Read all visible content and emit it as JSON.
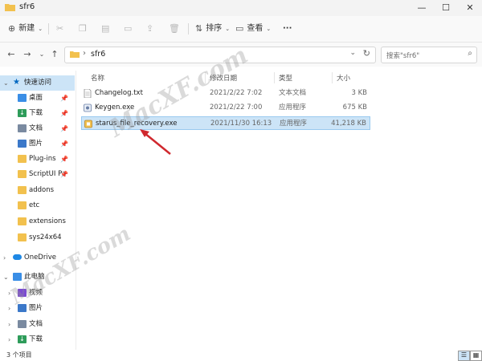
{
  "window": {
    "title": "sfr6",
    "minimize": "—",
    "maximize": "☐",
    "close": "✕"
  },
  "toolbar": {
    "new_label": "新建",
    "sort_label": "排序",
    "view_label": "查看",
    "more_label": "···"
  },
  "address": {
    "path": "sfr6",
    "separator": "›"
  },
  "search": {
    "placeholder": "搜索\"sfr6\""
  },
  "sidebar": {
    "items": [
      {
        "label": "快速访问",
        "icon": "star-icon",
        "expanded": true,
        "selected": true
      },
      {
        "label": "桌面",
        "icon": "desktop-icon",
        "pinned": true
      },
      {
        "label": "下载",
        "icon": "download-icon",
        "pinned": true
      },
      {
        "label": "文档",
        "icon": "document-icon",
        "pinned": true
      },
      {
        "label": "图片",
        "icon": "picture-icon",
        "pinned": true
      },
      {
        "label": "Plug-ins",
        "icon": "folder-icon",
        "pinned": true
      },
      {
        "label": "ScriptUI Pa",
        "icon": "folder-icon",
        "pinned": true
      },
      {
        "label": "addons",
        "icon": "folder-icon"
      },
      {
        "label": "etc",
        "icon": "folder-icon"
      },
      {
        "label": "extensions",
        "icon": "folder-icon"
      },
      {
        "label": "sys24x64",
        "icon": "folder-icon"
      },
      {
        "label": "OneDrive",
        "icon": "cloud-icon"
      },
      {
        "label": "此电脑",
        "icon": "computer-icon",
        "expanded": true
      },
      {
        "label": "视频",
        "icon": "video-icon"
      },
      {
        "label": "图片",
        "icon": "picture-icon"
      },
      {
        "label": "文档",
        "icon": "document-icon"
      },
      {
        "label": "下载",
        "icon": "download-icon"
      }
    ]
  },
  "columns": {
    "name": "名称",
    "modified": "修改日期",
    "type": "类型",
    "size": "大小"
  },
  "files": [
    {
      "name": "Changelog.txt",
      "modified": "2021/2/22 7:02",
      "type": "文本文档",
      "size": "3 KB",
      "icon": "text-file-icon"
    },
    {
      "name": "Keygen.exe",
      "modified": "2021/2/22 7:00",
      "type": "应用程序",
      "size": "675 KB",
      "icon": "app-icon"
    },
    {
      "name": "starus_file_recovery.exe",
      "modified": "2021/11/30 16:13",
      "type": "应用程序",
      "size": "41,218 KB",
      "icon": "app-icon",
      "selected": true
    }
  ],
  "status": {
    "count": "3 个项目"
  },
  "watermark": {
    "text": "MacXF.com"
  },
  "colors": {
    "selection": "#cce4f7",
    "folder": "#f2c14e",
    "accent": "#0067c0",
    "arrow": "#d0282e"
  }
}
